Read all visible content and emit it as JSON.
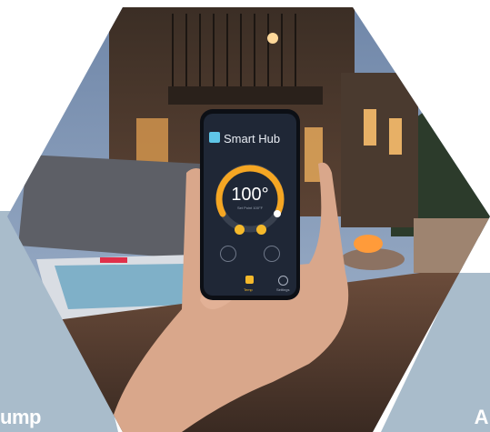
{
  "captions": {
    "left": "ump",
    "right": "A"
  },
  "phone_app": {
    "title": "Smart Hub",
    "temperature": "100°",
    "subtitle": "Set Point 100°F",
    "tabs": {
      "temp_label": "Temp",
      "settings_label": "Settings"
    }
  },
  "colors": {
    "side_panel": "#a9bccb",
    "dial_orange": "#f5a623",
    "phone_bg": "#1f2736",
    "hub_logo": "#5fc6e8"
  },
  "icons": [
    "smart-hub-logo-icon",
    "light-bulb-icon",
    "speed-gauge-icon",
    "thermometer-icon",
    "gear-icon"
  ]
}
